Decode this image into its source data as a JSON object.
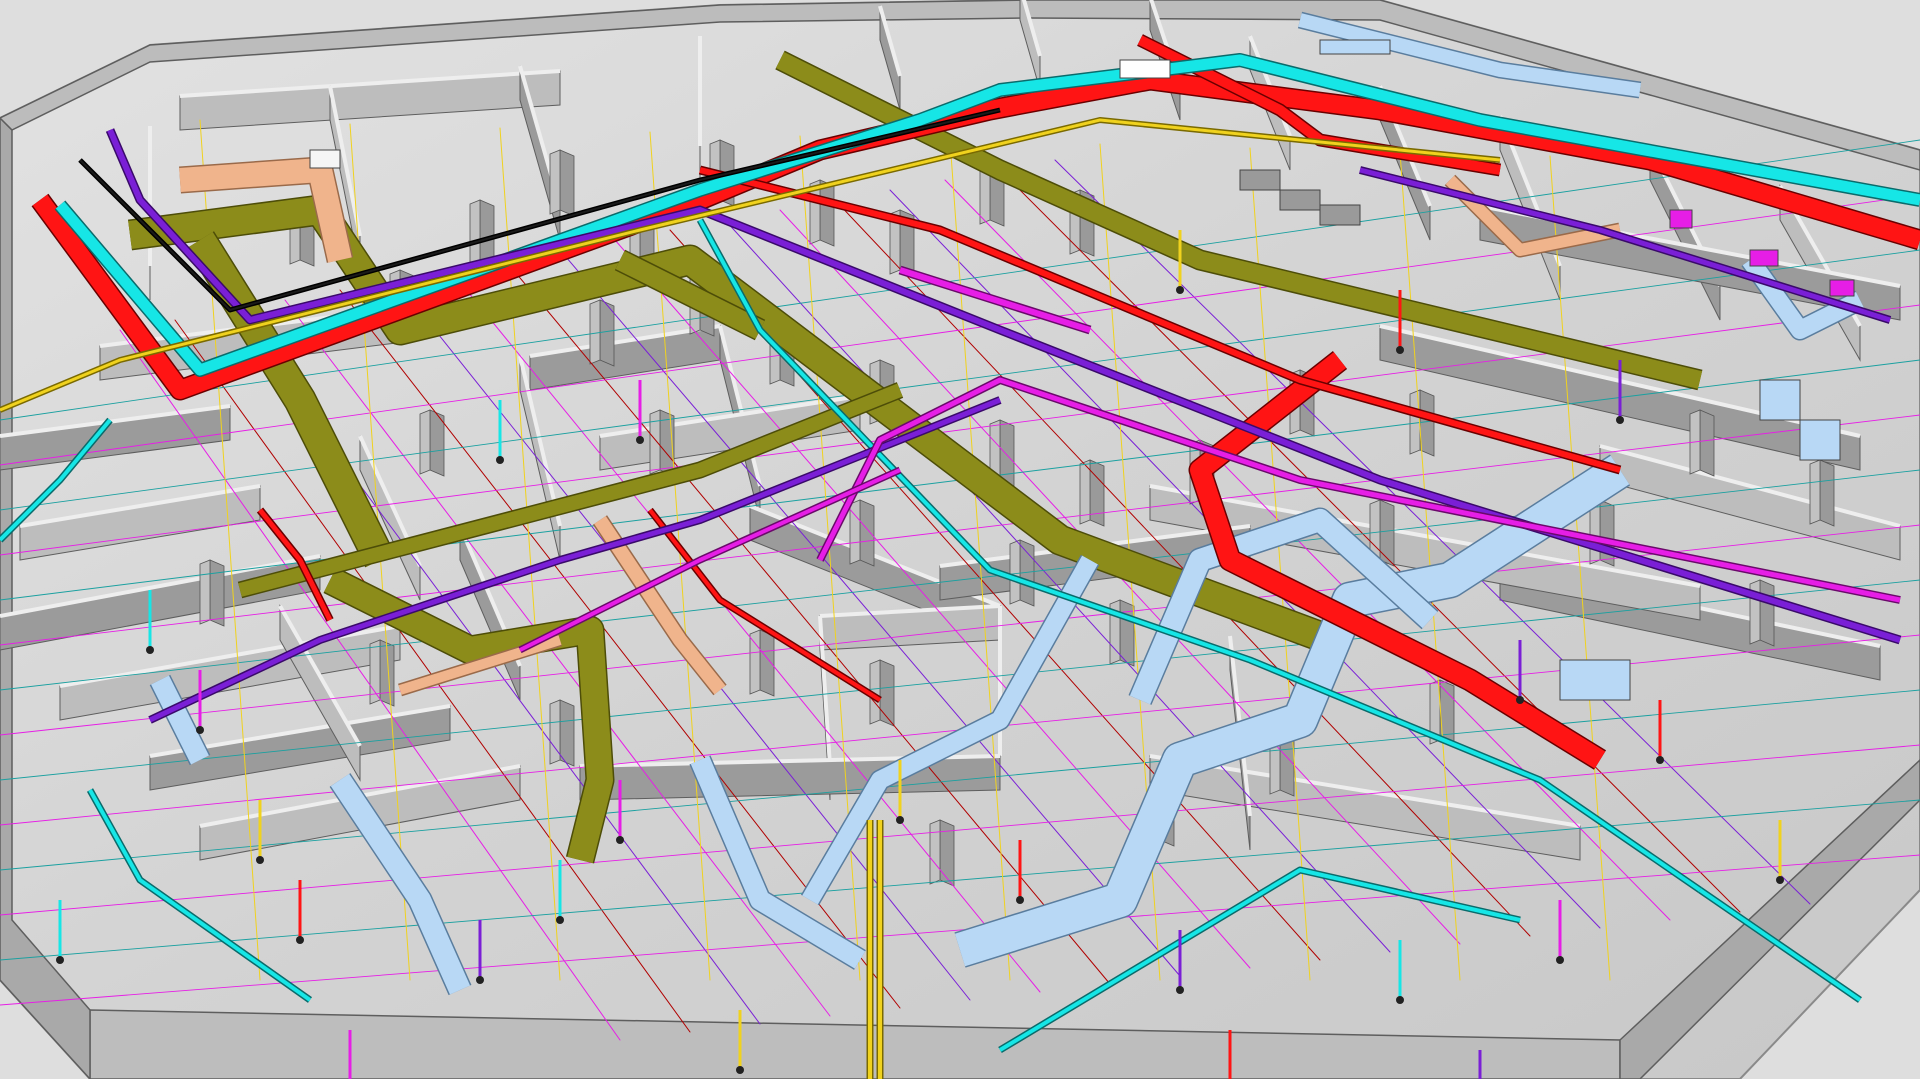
{
  "viewport": {
    "background": "#dedede"
  },
  "palette": {
    "slab": "#cfcfcf",
    "slab_edge": "#8a8a8a",
    "wall_top": "#bdbdbd",
    "wall_side": "#9b9b9b",
    "wall_edge": "#5e5e5e",
    "column": "#a8a8a8",
    "red": "#ff1414",
    "cyan": "#16e6e6",
    "olive": "#8c8c1a",
    "olive_edge": "#4d4d08",
    "purple": "#7a1fd6",
    "magenta": "#e61ee6",
    "yellow": "#f0d21e",
    "pale_blue": "#b8d8f5",
    "peach": "#f0b48c",
    "dark_red": "#b00000",
    "teal": "#1aa0a0",
    "black": "#1a1a1a"
  },
  "systems": [
    {
      "id": "supply-air",
      "color_key": "olive"
    },
    {
      "id": "return-air",
      "color_key": "pale_blue"
    },
    {
      "id": "exhaust-air",
      "color_key": "peach"
    },
    {
      "id": "fire-main",
      "color_key": "red"
    },
    {
      "id": "cold-water",
      "color_key": "cyan"
    },
    {
      "id": "hot-water",
      "color_key": "purple"
    },
    {
      "id": "sprinkler",
      "color_key": "magenta"
    },
    {
      "id": "gas",
      "color_key": "yellow"
    }
  ]
}
